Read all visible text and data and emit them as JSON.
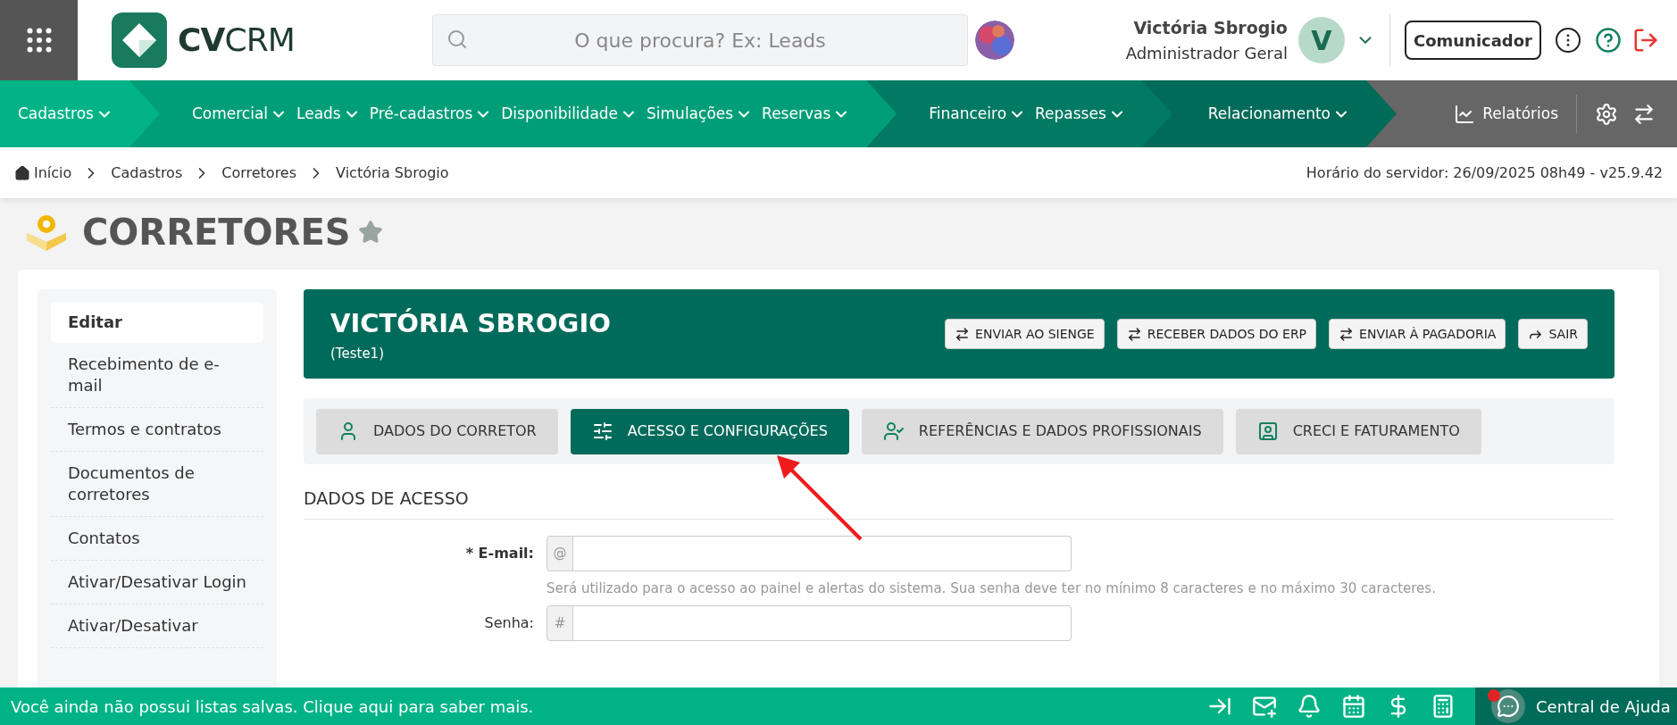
{
  "header": {
    "logo": {
      "bold": "CV",
      "light": "CRM"
    },
    "search": {
      "placeholder": "O que procura? Ex: Leads"
    },
    "user": {
      "name": "Victória Sbrogio",
      "role": "Administrador Geral",
      "initial": "V"
    },
    "communicator": "Comunicador"
  },
  "nav": {
    "groups": [
      {
        "color": "#00b386",
        "items": [
          "Cadastros"
        ]
      },
      {
        "color": "#009e78",
        "items": [
          "Comercial",
          "Leads",
          "Pré-cadastros",
          "Disponibilidade",
          "Simulações",
          "Reservas"
        ]
      },
      {
        "color": "#007a62",
        "items": [
          "Financeiro",
          "Repasses"
        ]
      },
      {
        "color": "#006b58",
        "items": [
          "Relacionamento"
        ]
      }
    ],
    "reports": "Relatórios"
  },
  "breadcrumb": [
    "Início",
    "Cadastros",
    "Corretores",
    "Victória Sbrogio"
  ],
  "server_time": "Horário do servidor: 26/09/2025 08h49 - v25.9.42",
  "page": {
    "title": "CORRETORES",
    "favorite": false
  },
  "sidebar": {
    "items": [
      {
        "label": "Editar",
        "selected": true
      },
      {
        "label": "Recebimento de e-mail",
        "selected": false
      },
      {
        "label": "Termos e contratos",
        "selected": false
      },
      {
        "label": "Documentos de corretores",
        "selected": false
      },
      {
        "label": "Contatos",
        "selected": false
      },
      {
        "label": "Ativar/Desativar Login",
        "selected": false
      },
      {
        "label": "Ativar/Desativar",
        "selected": false
      }
    ]
  },
  "profile": {
    "name": "VICTÓRIA SBROGIO",
    "subtitle": "(Teste1)",
    "actions": [
      {
        "label": "ENVIAR AO SIENGE",
        "kind": "swap"
      },
      {
        "label": "RECEBER DADOS DO ERP",
        "kind": "swap"
      },
      {
        "label": "ENVIAR À PAGADORIA",
        "kind": "swap"
      },
      {
        "label": "SAIR",
        "kind": "exit"
      }
    ]
  },
  "tabs": [
    {
      "label": "DADOS DO CORRETOR",
      "selected": false
    },
    {
      "label": "ACESSO E CONFIGURAÇÕES",
      "selected": true
    },
    {
      "label": "REFERÊNCIAS E DADOS PROFISSIONAIS",
      "selected": false
    },
    {
      "label": "CRECI E FATURAMENTO",
      "selected": false
    }
  ],
  "section": {
    "title": "DADOS DE ACESSO",
    "fields": [
      {
        "label": "* E-mail:",
        "required": true,
        "addon": "@",
        "help": "Será utilizado para o acesso ao painel e alertas do sistema. Sua senha deve ter no mínimo 8 caracteres e no máximo 30 caracteres."
      },
      {
        "label": "Senha:",
        "required": false,
        "addon": "#"
      }
    ]
  },
  "footer": {
    "message": "Você ainda não possui listas salvas. Clique aqui para saber mais.",
    "help": "Central de Ajuda",
    "help_notification": true
  }
}
